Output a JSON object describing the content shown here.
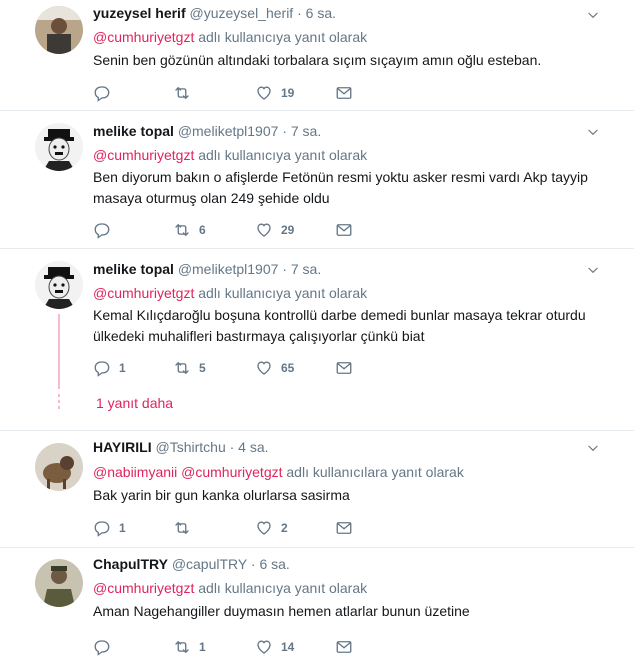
{
  "replying_suffix": "adlı kullanıcıya yanıt olarak",
  "replying_suffix_plural": "adlı kullanıcılara yanıt olarak",
  "tweets": [
    {
      "name": "yuzeysel herif",
      "handle": "@yuzeysel_herif",
      "time": "· 6 sa.",
      "mention1": "@cumhuriyetgzt",
      "text": "Senin ben gözünün altındaki torbalara sıçım sıçayım amın oğlu esteban.",
      "reply_count": "",
      "retweet_count": "",
      "like_count": "19"
    },
    {
      "name": "melike topal",
      "handle": "@meliketpl1907",
      "time": "· 7 sa.",
      "mention1": "@cumhuriyetgzt",
      "text": "Ben diyorum bakın o afişlerde Fetönün resmi yoktu asker resmi vardı Akp  tayyip masaya oturmuş olan 249 şehide oldu",
      "reply_count": "",
      "retweet_count": "6",
      "like_count": "29"
    },
    {
      "name": "melike topal",
      "handle": "@meliketpl1907",
      "time": "· 7 sa.",
      "mention1": "@cumhuriyetgzt",
      "text": "Kemal Kılıçdaroğlu boşuna kontrollü darbe demedi bunlar masaya tekrar oturdu ülkedeki muhalifleri bastırmaya çalışıyorlar çünkü biat",
      "reply_count": "1",
      "retweet_count": "5",
      "like_count": "65",
      "more_replies": "1 yanıt daha"
    },
    {
      "name": "HAYIRILI",
      "handle": "@Tshirtchu",
      "time": "· 4 sa.",
      "mention1": "@nabiimyanii",
      "mention2": "@cumhuriyetgzt",
      "text": "Bak yarin bir gun kanka olurlarsa sasirma",
      "reply_count": "1",
      "retweet_count": "",
      "like_count": "2"
    },
    {
      "name": "ChapulTRY",
      "handle": "@capulTRY",
      "time": "· 6 sa.",
      "mention1": "@cumhuriyetgzt",
      "text": "Aman Nagehangiller duymasın hemen atlarlar bunun üzetine",
      "reply_count": "",
      "retweet_count": "1",
      "like_count": "14"
    }
  ],
  "colors": {
    "accent": "#e0245e",
    "muted": "#657786",
    "text": "#14171a",
    "divider": "#e6ecf0"
  },
  "icons": [
    "reply-icon",
    "retweet-icon",
    "like-icon",
    "direct-message-icon",
    "caret-down-icon"
  ]
}
